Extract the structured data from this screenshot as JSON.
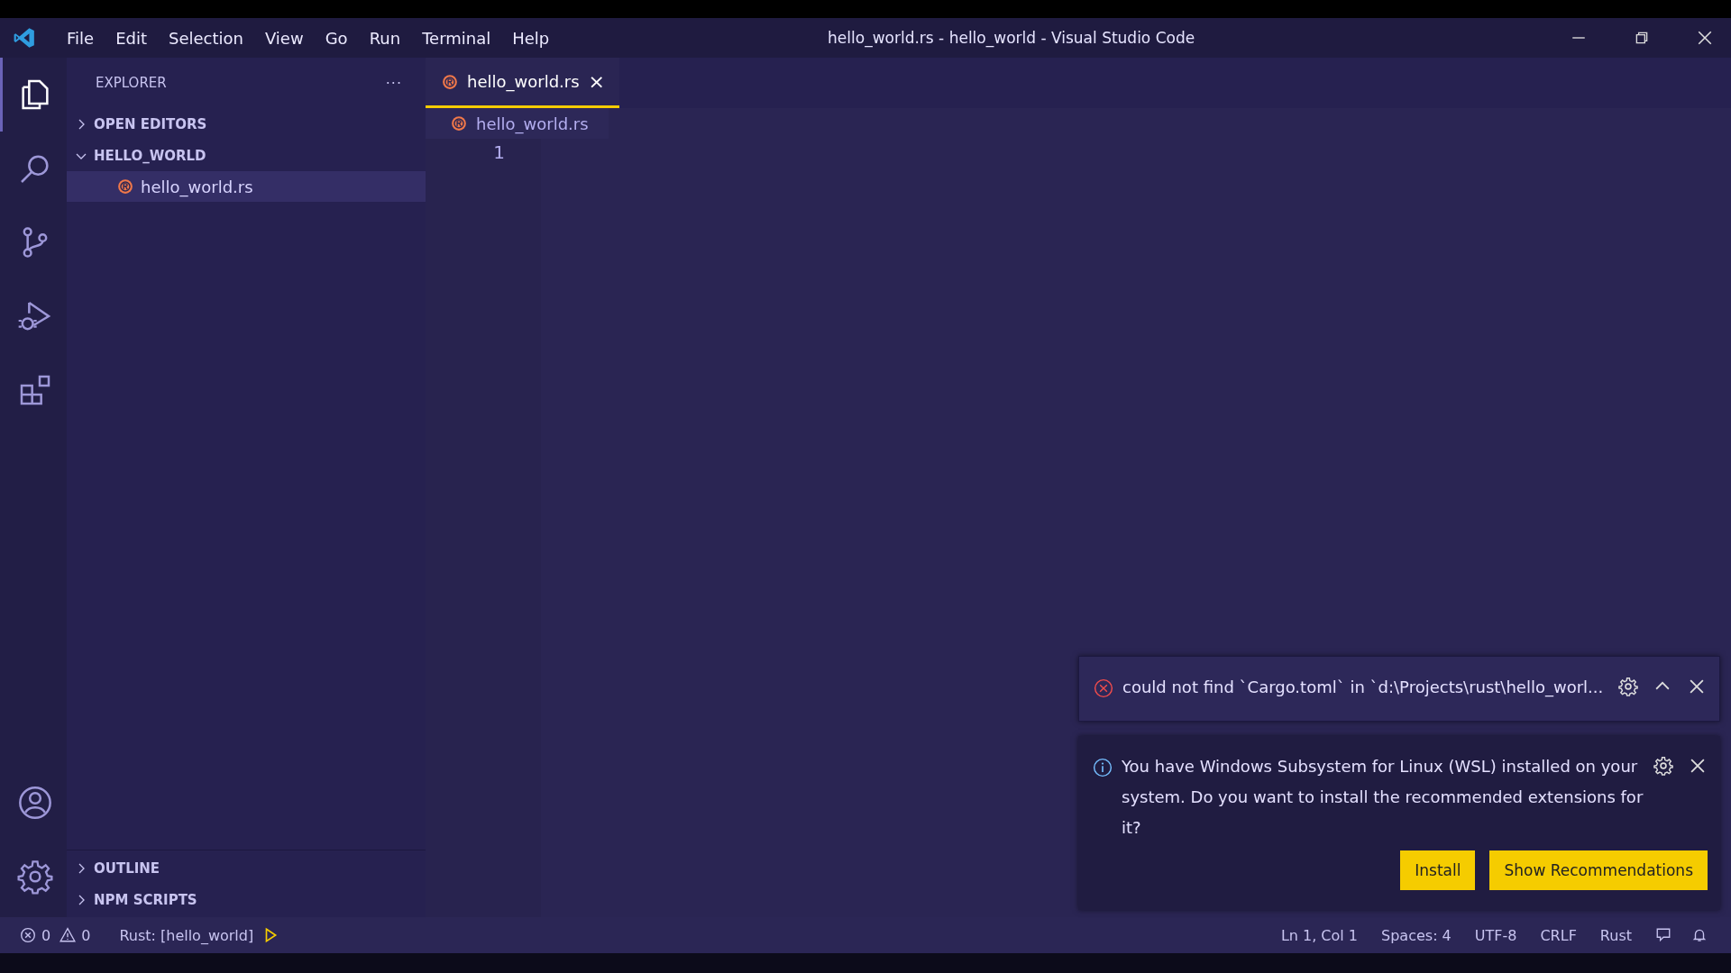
{
  "window": {
    "title": "hello_world.rs - hello_world - Visual Studio Code"
  },
  "menu": [
    "File",
    "Edit",
    "Selection",
    "View",
    "Go",
    "Run",
    "Terminal",
    "Help"
  ],
  "activity_bar": [
    {
      "kind": "files",
      "selected": true
    },
    {
      "kind": "search",
      "selected": false
    },
    {
      "kind": "scm",
      "selected": false
    },
    {
      "kind": "debug",
      "selected": false
    },
    {
      "kind": "extensions",
      "selected": false
    }
  ],
  "activity_bottom": [
    {
      "kind": "account"
    },
    {
      "kind": "settings"
    }
  ],
  "sidebar": {
    "title": "EXPLORER",
    "more": "···",
    "sections": [
      {
        "label": "OPEN EDITORS",
        "expanded": false
      },
      {
        "label": "HELLO_WORLD",
        "expanded": true,
        "children": [
          {
            "label": "hello_world.rs",
            "selected": true
          }
        ]
      }
    ],
    "bottom_sections": [
      {
        "label": "OUTLINE",
        "expanded": false
      },
      {
        "label": "NPM SCRIPTS",
        "expanded": false
      }
    ]
  },
  "tabs": [
    {
      "label": "hello_world.rs",
      "selected": true,
      "close": "×"
    }
  ],
  "breadcrumb": "hello_world.rs",
  "editor": {
    "line_numbers": [
      "1"
    ]
  },
  "notifications": [
    {
      "kind": "error",
      "message": "could not find `Cargo.toml` in `d:\\Projects\\rust\\hello_worl..."
    },
    {
      "kind": "info",
      "message": "You have Windows Subsystem for Linux (WSL) installed on your system. Do you want to install the recommended extensions for it?",
      "buttons": [
        "Install",
        "Show Recommendations"
      ]
    }
  ],
  "status_bar": {
    "errors": "0",
    "warnings": "0",
    "target": "Rust: [hello_world]",
    "right": [
      "Ln 1, Col 1",
      "Spaces: 4",
      "UTF-8",
      "CRLF",
      "Rust"
    ]
  }
}
